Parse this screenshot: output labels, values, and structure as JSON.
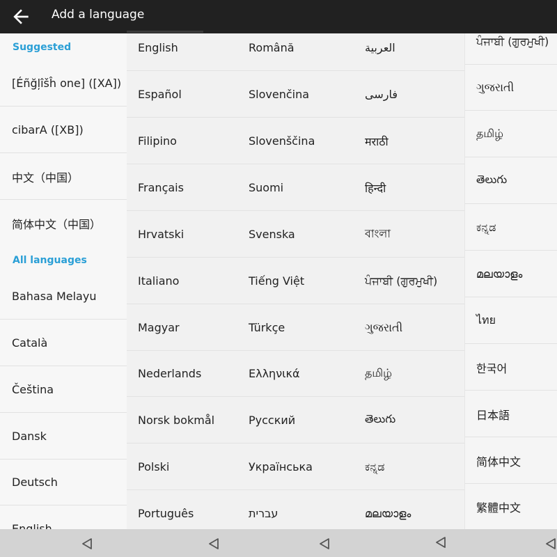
{
  "appbar": {
    "title": "Add a language",
    "back_icon": "arrow-left-icon"
  },
  "left_panel": {
    "suggested_header": "Suggested",
    "suggested": [
      "[Éñğļîšĥ one] ([XA])",
      "cibarA ([XB])",
      "中文（中国）",
      "简体中文（中国）"
    ],
    "all_header": "All languages",
    "all": [
      "Bahasa Melayu",
      "Català",
      "Čeština",
      "Dansk",
      "Deutsch",
      "English"
    ]
  },
  "panel2": [
    "English",
    "Español",
    "Filipino",
    "Français",
    "Hrvatski",
    "Italiano",
    "Magyar",
    "Nederlands",
    "Norsk bokmål",
    "Polski",
    "Português"
  ],
  "panel3": [
    "Română",
    "Slovenčina",
    "Slovenščina",
    "Suomi",
    "Svenska",
    "Tiếng Việt",
    "Türkçe",
    "Ελληνικά",
    "Русский",
    "Українська",
    "עברית"
  ],
  "panel4": [
    "العربية",
    "فارسی",
    "मराठी",
    "हिन्दी",
    "বাংলা",
    "ਪੰਜਾਬੀ (ਗੁਰਮੁਖੀ)",
    "ગુજરાતી",
    "தமிழ்",
    "తెలుగు",
    "ಕನ್ನಡ",
    "മലയാളം"
  ],
  "panel5": [
    "ਪੰਜਾਬੀ (ਗੁਰਮੁਖੀ)",
    "ગુજરાતી",
    "தமிழ்",
    "తెలుగు",
    "ಕನ್ನಡ",
    "മലയാളം",
    "ไทย",
    "한국어",
    "日本語",
    "简体中文",
    "繁體中文"
  ],
  "navbar": {
    "back_icon": "triangle-back-icon"
  }
}
